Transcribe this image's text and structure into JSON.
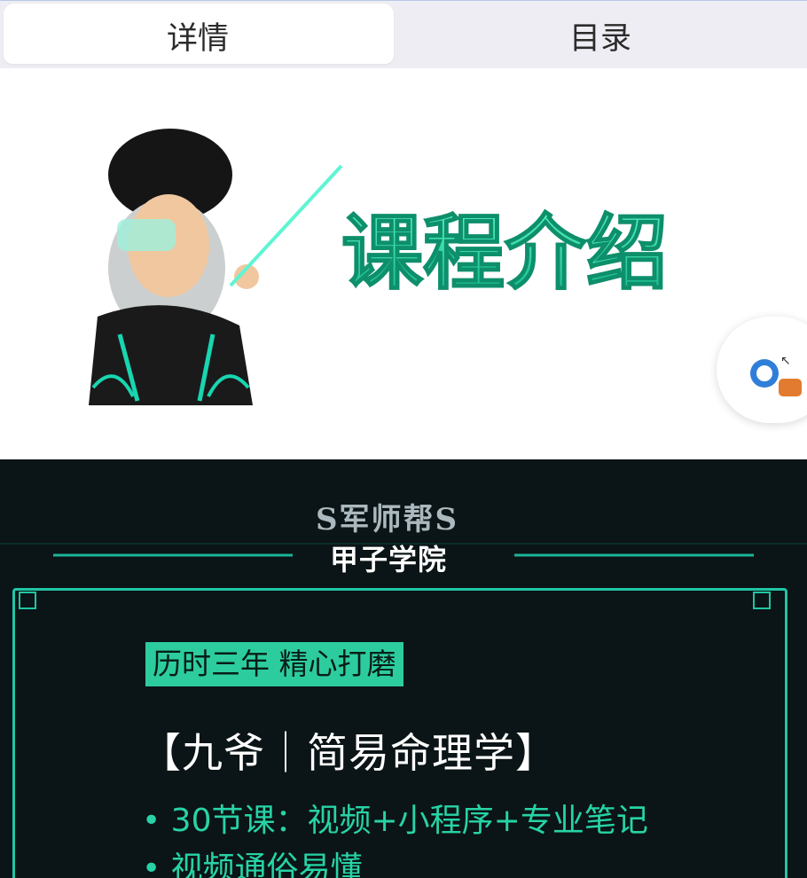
{
  "tabs": [
    {
      "label": "详情",
      "active": true
    },
    {
      "label": "目录",
      "active": false
    }
  ],
  "banner": {
    "title": "课程介绍",
    "title_color": "#2bd9a3"
  },
  "dark": {
    "brand_logo": "S军师帮S",
    "brand_name": "甲子学院",
    "tagline": "历时三年 精心打磨",
    "course_title": "【九爷｜简易命理学】",
    "bullets": [
      "• 30节课：视频+小程序+专业笔记",
      "• 视频通俗易懂"
    ],
    "accent": "#1fc6a5"
  }
}
